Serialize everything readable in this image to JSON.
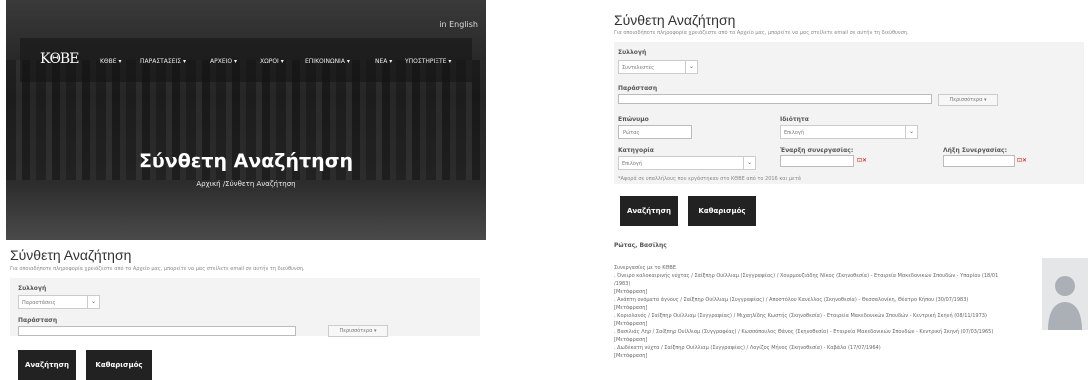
{
  "hero": {
    "lang": "in English",
    "logo": "KΘBE",
    "nav": [
      "ΚΘΒΕ ▾",
      "ΠΑΡΑΣΤΑΣΕΙΣ ▾",
      "ΑΡΧΕΙΟ ▾",
      "ΧΩΡΟΙ ▾",
      "ΕΠΙΚΟΙΝΩΝΙΑ ▾",
      "ΝΕΑ ▾",
      "ΥΠΟΣΤΗΡΙΞΤΕ ▾"
    ],
    "title": "Σύνθετη Αναζήτηση",
    "breadcrumb": "Αρχική /Σύνθετη Αναζήτηση"
  },
  "left": {
    "title": "Σύνθετη Αναζήτηση",
    "intro": "Για οποιαδήποτε πληροφορία χρειάζεστε από το Αρχείο μας, μπορείτε να μας στείλετε email σε αυτήν τη διεύθυνση.",
    "collection_label": "Συλλογή",
    "collection_value": "Παραστάσεις",
    "performance_label": "Παράσταση",
    "more_label": "Περισσότερα ▾",
    "search_label": "Αναζήτηση",
    "clear_label": "Καθαρισμός"
  },
  "right": {
    "title": "Σύνθετη Αναζήτηση",
    "intro": "Για οποιαδήποτε πληροφορία χρειάζεστε από το Αρχείο μας, μπορείτε να μας στείλετε email σε αυτήν τη διεύθυνση.",
    "collection_label": "Συλλογή",
    "collection_value": "Συντελεστές",
    "performance_label": "Παράσταση",
    "more_label": "Περισσότερα ▾",
    "surname_label": "Επώνυμο",
    "surname_value": "Ρώτας",
    "role_label": "Ιδιότητα",
    "role_value": "Επιλογή",
    "category_label": "Κατηγορία",
    "category_value": "Επιλογή",
    "start_label": "Έναρξη συνεργασίας:",
    "end_label": "Λήξη Συνεργασίας:",
    "note": "*Αφορά σε υπαλλήλους που εργάστηκαν στο ΚΘΒΕ από το 2016 και μετά",
    "search_label": "Αναζήτηση",
    "clear_label": "Καθαρισμός",
    "result_name": "Ρώτας, Βασίλης",
    "result_heading": "Συνεργασίες με το ΚΘΒΕ",
    "results": [
      ". Όνειρο καλοκαιρινής νύχτας / Σαίξπηρ Ουίλλιαμ (Συγγραφέας) / Χουρμουζιάδης Νίκος (Σκηνοθεσία) - Εταιρεία Μακεδονικών Σπουδών - Υπαρίου (18/01",
      "/1983)",
      "[Μετάφραση]",
      ". Ανάπτη ονόματα άγνους / Σαίξπηρ Ουίλλιαμ (Συγγραφέας) / Αποστόλου Κανέλλος (Σκηνοθεσία) - Θεσσαλονίκη, Θέατρο Κήπου (30/07/1983)",
      "[Μετάφραση]",
      ". Κοριολανός / Σαίξπηρ Ουίλλιαμ (Συγγραφέας) / Μιχαηλίδης Κωστής (Σκηνοθεσία) - Εταιρεία Μακεδονικών Σπουδών - Κεντρική Σκηνή (08/11/1973)",
      "[Μετάφραση]",
      ". Βασιλιάς Ληρ / Σαίξπηρ Ουίλλιαμ (Συγγραφέας) / Κωσσόπουλος Θάνος (Σκηνοθεσία) - Εταιρεία Μακεδονικών Σπουδών - Κεντρική Σκηνή (07/03/1965)",
      "[Μετάφραση]",
      ". Δωδέκατη νύχτα / Σαίξπηρ Ουίλλιαμ (Συγγραφέας) / Λογίζος Μήνος (Σκηνοθεσία) - Καβάλα (17/07/1964)",
      "[Μετάφραση]"
    ]
  }
}
